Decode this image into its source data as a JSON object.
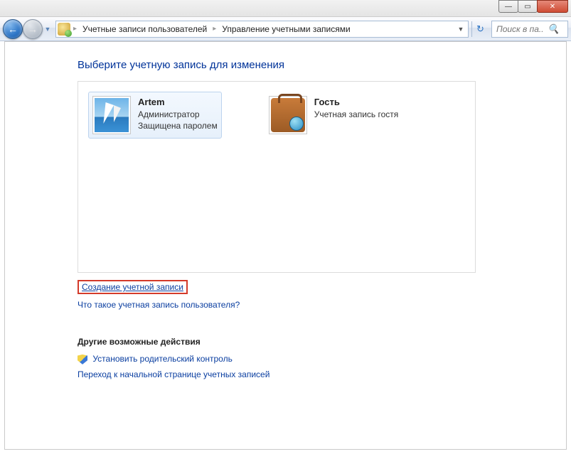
{
  "titlebar": {
    "minimize": "—",
    "maximize": "▭",
    "close": "✕"
  },
  "toolbar": {
    "back": "←",
    "forward": "→",
    "dropdown": "▼",
    "breadcrumb1": "Учетные записи пользователей",
    "breadcrumb2": "Управление учетными записями",
    "sep": "▸",
    "refresh": "↻",
    "search_placeholder": "Поиск в па..."
  },
  "page": {
    "title": "Выберите учетную запись для изменения",
    "accounts": [
      {
        "name": "Artem",
        "line2": "Администратор",
        "line3": "Защищена паролем"
      },
      {
        "name": "Гость",
        "line2": "Учетная запись гостя",
        "line3": ""
      }
    ],
    "create_link": "Создание учетной записи",
    "what_is_link": "Что такое учетная запись пользователя?",
    "other_heading": "Другие возможные действия",
    "parental_link": "Установить родительский контроль",
    "goto_link": "Переход к начальной странице учетных записей"
  }
}
